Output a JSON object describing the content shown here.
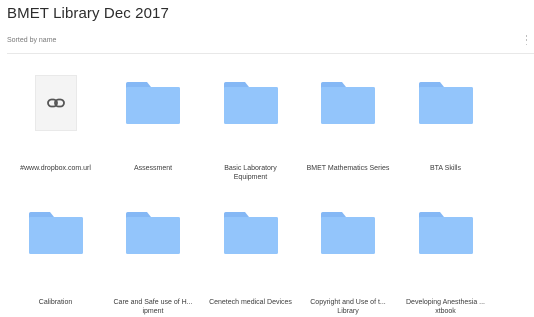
{
  "header": {
    "title": "BMET Library Dec 2017",
    "sort_label": "Sorted by name"
  },
  "colors": {
    "folder_body": "#93c5fb",
    "folder_tab": "#85b8f5",
    "file_bg": "#f4f4f4",
    "link_icon": "#555555"
  },
  "items": [
    {
      "name": "#www.dropbox.com.url",
      "lines": [
        "#www.dropbox.com.url"
      ],
      "kind": "file",
      "icon": "link-icon"
    },
    {
      "name": "Assessment",
      "lines": [
        "Assessment"
      ],
      "kind": "folder",
      "icon": "folder-icon"
    },
    {
      "name": "Basic Laboratory Equipment",
      "lines": [
        "Basic Laboratory",
        "Equipment"
      ],
      "kind": "folder",
      "icon": "folder-icon"
    },
    {
      "name": "BMET Mathematics Series",
      "lines": [
        "BMET Mathematics Series"
      ],
      "kind": "folder",
      "icon": "folder-icon"
    },
    {
      "name": "BTA Skills",
      "lines": [
        "BTA Skills"
      ],
      "kind": "folder",
      "icon": "folder-icon"
    },
    {
      "name": "Calibration",
      "lines": [
        "Calibration"
      ],
      "kind": "folder",
      "icon": "folder-icon"
    },
    {
      "name": "Care and Safe use of H...ipment",
      "lines": [
        "Care and Safe use of H...",
        "ipment"
      ],
      "kind": "folder",
      "icon": "folder-icon"
    },
    {
      "name": "Cenetech medical Devices",
      "lines": [
        "Cenetech medical Devices"
      ],
      "kind": "folder",
      "icon": "folder-icon"
    },
    {
      "name": "Copyright and Use of t...Library",
      "lines": [
        "Copyright and Use of t...",
        "Library"
      ],
      "kind": "folder",
      "icon": "folder-icon"
    },
    {
      "name": "Developing Anesthesia ...xtbook",
      "lines": [
        "Developing Anesthesia ...",
        "xtbook"
      ],
      "kind": "folder",
      "icon": "folder-icon"
    }
  ]
}
